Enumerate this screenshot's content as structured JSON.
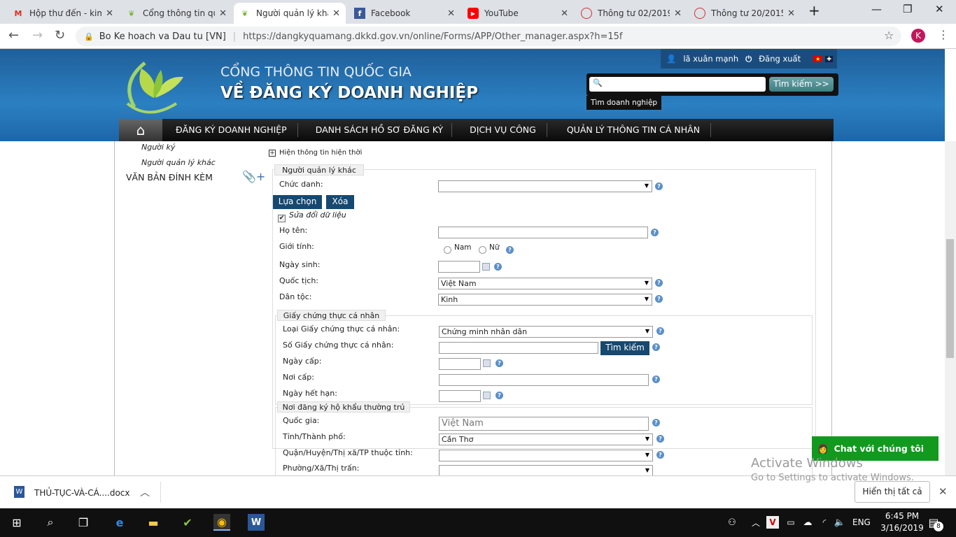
{
  "browser": {
    "tabs": [
      {
        "label": "Hộp thư đến - kim",
        "icon": "gmail-icon"
      },
      {
        "label": "Cổng thông tin qu",
        "icon": "portal-icon"
      },
      {
        "label": "Người quản lý khá",
        "icon": "portal-icon",
        "active": true
      },
      {
        "label": "Facebook",
        "icon": "facebook-icon"
      },
      {
        "label": "YouTube",
        "icon": "youtube-icon"
      },
      {
        "label": "Thông tư 02/2019",
        "icon": "gov-icon"
      },
      {
        "label": "Thông tư 20/2015",
        "icon": "gov-icon"
      }
    ],
    "site_identity": "Bo Ke hoach va Dau tu [VN]",
    "url": "https://dangkyquamang.dkkd.gov.vn/online/Forms/APP/Other_manager.aspx?h=15f",
    "profile_initial": "K"
  },
  "header": {
    "title_line1": "CỔNG THÔNG TIN QUỐC GIA",
    "title_line2": "VỀ ĐĂNG KÝ DOANH NGHIỆP",
    "user": "lã xuân mạnh",
    "logout": "Đăng xuất",
    "search_value": "",
    "search_button": "Tìm kiếm >>",
    "search_tab": "Tìm doanh nghiệp"
  },
  "nav": [
    "ĐĂNG KÝ DOANH NGHIỆP",
    "DANH SÁCH HỒ SƠ ĐĂNG KÝ",
    "DỊCH VỤ CÔNG",
    "QUẢN LÝ THÔNG TIN CÁ NHÂN"
  ],
  "sidebar": {
    "items": [
      "Người ký",
      "Người quản lý khác"
    ],
    "attachments": "VĂN BẢN ĐÍNH KÈM"
  },
  "form": {
    "show_current": "Hiện thông tin hiện thời",
    "section1": "Người quản lý khác",
    "chuc_danh_label": "Chức danh:",
    "chuc_danh_value": "",
    "select_btn": "Lựa chọn",
    "delete_btn": "Xóa",
    "edit_checkbox": "Sửa đổi dữ liệu",
    "edit_checked": true,
    "ho_ten_label": "Họ tên:",
    "ho_ten_value": "",
    "gioi_tinh_label": "Giới tính:",
    "nam": "Nam",
    "nu": "Nữ",
    "ngay_sinh_label": "Ngày sinh:",
    "ngay_sinh_value": "",
    "quoc_tich_label": "Quốc tịch:",
    "quoc_tich_value": "Việt Nam",
    "dan_toc_label": "Dân tộc:",
    "dan_toc_value": "Kinh",
    "section2": "Giấy chứng thực cá nhân",
    "loai_giay_label": "Loại Giấy chứng thực cá nhân:",
    "loai_giay_value": "Chứng minh nhân dân",
    "so_giay_label": "Số Giấy chứng thực cá nhân:",
    "so_giay_value": "",
    "search_btn": "Tìm kiếm",
    "ngay_cap_label": "Ngày cấp:",
    "noi_cap_label": "Nơi cấp:",
    "ngay_het_han_label": "Ngày hết hạn:",
    "section3": "Nơi đăng ký hộ khẩu thường trú",
    "quoc_gia_label": "Quốc gia:",
    "quoc_gia_value": "Việt Nam",
    "tinh_label": "Tỉnh/Thành phố:",
    "tinh_value": "Cần Thơ",
    "quan_label": "Quận/Huyện/Thị xã/TP thuộc tỉnh:",
    "quan_value": "",
    "phuong_label": "Phường/Xã/Thị trấn:"
  },
  "chat": "Chat với chúng tôi",
  "watermark": {
    "line1": "Activate Windows",
    "line2": "Go to Settings to activate Windows."
  },
  "download": {
    "file": "THỦ-TỤC-VÀ-CÁ....docx",
    "show_all": "Hiển thị tất cả"
  },
  "taskbar": {
    "lang": "ENG",
    "time": "6:45 PM",
    "date": "3/16/2019",
    "notifications": "8"
  },
  "colors": {
    "header_blue": "#2b80c2",
    "button_navy": "#17486f",
    "chat_green": "#119a1e"
  }
}
